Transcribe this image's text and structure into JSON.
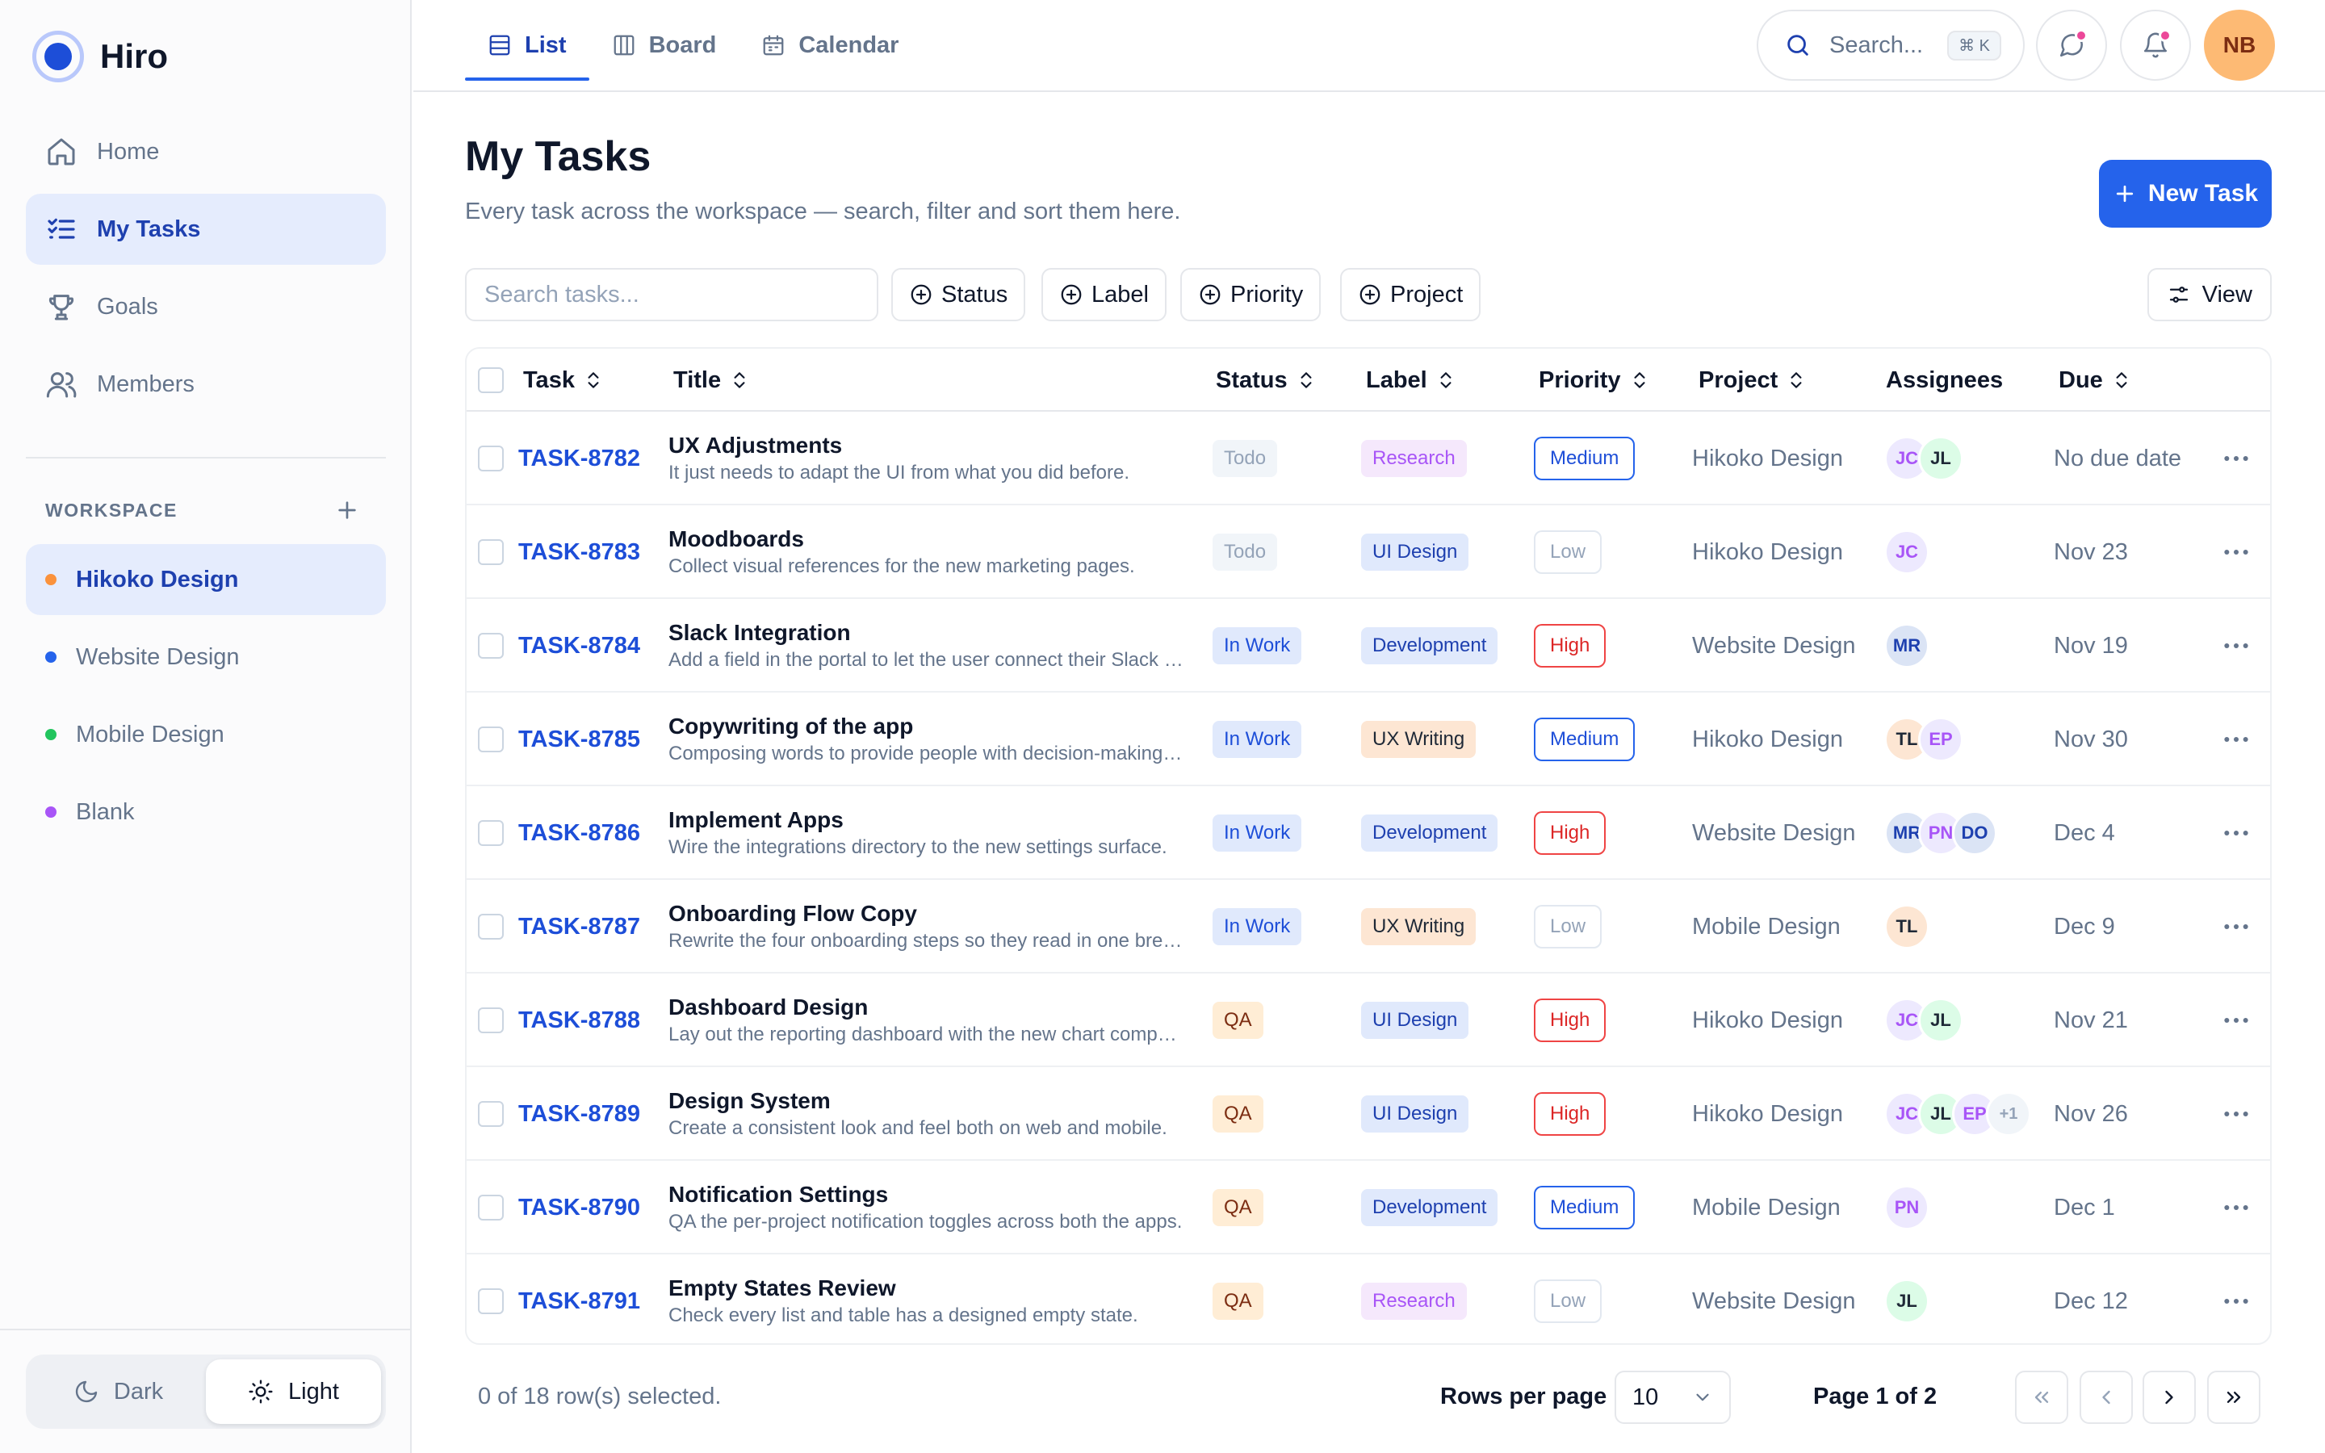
{
  "brand": {
    "name": "Hiro"
  },
  "sidebar": {
    "nav": [
      {
        "label": "Home",
        "icon": "home-icon"
      },
      {
        "label": "My Tasks",
        "icon": "task-list-icon",
        "active": true
      },
      {
        "label": "Goals",
        "icon": "trophy-icon"
      },
      {
        "label": "Members",
        "icon": "users-icon"
      }
    ],
    "workspace_title": "WORKSPACE",
    "workspaces": [
      {
        "label": "Hikoko Design",
        "color": "#fb923c",
        "active": true
      },
      {
        "label": "Website Design",
        "color": "#2563eb"
      },
      {
        "label": "Mobile Design",
        "color": "#22c55e"
      },
      {
        "label": "Blank",
        "color": "#a855f7"
      }
    ],
    "theme": {
      "dark": "Dark",
      "light": "Light",
      "selected": "light"
    }
  },
  "topbar": {
    "tabs": [
      {
        "label": "List",
        "icon": "list-icon",
        "active": true
      },
      {
        "label": "Board",
        "icon": "board-icon"
      },
      {
        "label": "Calendar",
        "icon": "calendar-icon"
      }
    ],
    "search_placeholder": "Search...",
    "shortcut": "⌘ K",
    "avatar": "NB"
  },
  "main": {
    "title": "My Tasks",
    "subtitle": "Every task across the workspace — search, filter and sort them here.",
    "new_task": "New Task",
    "search_placeholder": "Search tasks...",
    "filters": [
      "Status",
      "Label",
      "Priority",
      "Project"
    ],
    "view_label": "View"
  },
  "table": {
    "columns": {
      "task": "Task",
      "title": "Title",
      "status": "Status",
      "label": "Label",
      "priority": "Priority",
      "project": "Project",
      "assignees": "Assignees",
      "due": "Due"
    },
    "rows": [
      {
        "id": "TASK-8782",
        "title": "UX Adjustments",
        "desc": "It just needs to adapt the UI from what you did before.",
        "status": "Todo",
        "label": "Research",
        "priority": "Medium",
        "project": "Hikoko Design",
        "assignees": [
          "JC",
          "JL"
        ],
        "due": "No due date"
      },
      {
        "id": "TASK-8783",
        "title": "Moodboards",
        "desc": "Collect visual references for the new marketing pages.",
        "status": "Todo",
        "label": "UI Design",
        "priority": "Low",
        "project": "Hikoko Design",
        "assignees": [
          "JC"
        ],
        "due": "Nov 23"
      },
      {
        "id": "TASK-8784",
        "title": "Slack Integration",
        "desc": "Add a field in the portal to let the user connect their Slack account.",
        "status": "In Work",
        "label": "Development",
        "priority": "High",
        "project": "Website Design",
        "assignees": [
          "MR"
        ],
        "due": "Nov 19"
      },
      {
        "id": "TASK-8785",
        "title": "Copywriting of the app",
        "desc": "Composing words to provide people with decision-making information.",
        "status": "In Work",
        "label": "UX Writing",
        "priority": "Medium",
        "project": "Hikoko Design",
        "assignees": [
          "TL",
          "EP"
        ],
        "due": "Nov 30"
      },
      {
        "id": "TASK-8786",
        "title": "Implement Apps",
        "desc": "Wire the integrations directory to the new settings surface.",
        "status": "In Work",
        "label": "Development",
        "priority": "High",
        "project": "Website Design",
        "assignees": [
          "MR",
          "PN",
          "DO"
        ],
        "due": "Dec 4"
      },
      {
        "id": "TASK-8787",
        "title": "Onboarding Flow Copy",
        "desc": "Rewrite the four onboarding steps so they read in one breath.",
        "status": "In Work",
        "label": "UX Writing",
        "priority": "Low",
        "project": "Mobile Design",
        "assignees": [
          "TL"
        ],
        "due": "Dec 9"
      },
      {
        "id": "TASK-8788",
        "title": "Dashboard Design",
        "desc": "Lay out the reporting dashboard with the new chart components.",
        "status": "QA",
        "label": "UI Design",
        "priority": "High",
        "project": "Hikoko Design",
        "assignees": [
          "JC",
          "JL"
        ],
        "due": "Nov 21"
      },
      {
        "id": "TASK-8789",
        "title": "Design System",
        "desc": "Create a consistent look and feel both on web and mobile.",
        "status": "QA",
        "label": "UI Design",
        "priority": "High",
        "project": "Hikoko Design",
        "assignees": [
          "JC",
          "JL",
          "EP"
        ],
        "extra": "+1",
        "due": "Nov 26"
      },
      {
        "id": "TASK-8790",
        "title": "Notification Settings",
        "desc": "QA the per-project notification toggles across both the apps.",
        "status": "QA",
        "label": "Development",
        "priority": "Medium",
        "project": "Mobile Design",
        "assignees": [
          "PN"
        ],
        "due": "Dec 1"
      },
      {
        "id": "TASK-8791",
        "title": "Empty States Review",
        "desc": "Check every list and table has a designed empty state.",
        "status": "QA",
        "label": "Research",
        "priority": "Low",
        "project": "Website Design",
        "assignees": [
          "JL"
        ],
        "due": "Dec 12"
      }
    ]
  },
  "footer": {
    "selection": "0 of 18 row(s) selected.",
    "rows_per_page_label": "Rows per page",
    "rows_per_page": "10",
    "page_info": "Page 1 of 2"
  }
}
